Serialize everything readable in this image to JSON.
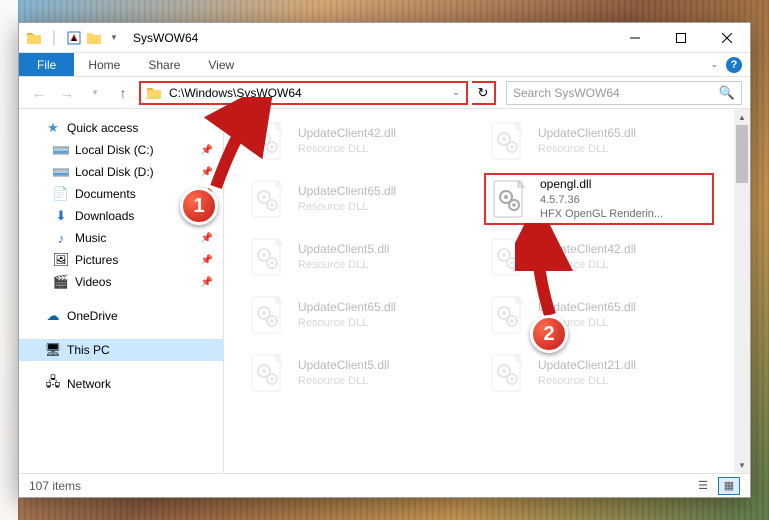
{
  "title": "SysWOW64",
  "ribbon": {
    "file": "File",
    "home": "Home",
    "share": "Share",
    "view": "View"
  },
  "address": {
    "path": "C:\\Windows\\SysWOW64"
  },
  "search": {
    "placeholder": "Search SysWOW64"
  },
  "nav": {
    "quick": "Quick access",
    "cdrive": "Local Disk (C:)",
    "ddrive": "Local Disk (D:)",
    "docs": "Documents",
    "downloads": "Downloads",
    "music": "Music",
    "pics": "Pictures",
    "videos": "Videos",
    "onedrive": "OneDrive",
    "thispc": "This PC",
    "network": "Network"
  },
  "files": [
    {
      "name": "UpdateClient42.dll",
      "sub1": "Resource DLL",
      "sub2": ""
    },
    {
      "name": "UpdateClient65.dll",
      "sub1": "Resource DLL",
      "sub2": ""
    },
    {
      "name": "UpdateClient65.dll",
      "sub1": "Resource DLL",
      "sub2": ""
    },
    {
      "name": "opengl.dll",
      "sub1": "4.5.7.36",
      "sub2": "HFX OpenGL Renderin..."
    },
    {
      "name": "UpdateClient5.dll",
      "sub1": "Resource DLL",
      "sub2": ""
    },
    {
      "name": "UpdateClient42.dll",
      "sub1": "Resource DLL",
      "sub2": ""
    },
    {
      "name": "UpdateClient65.dll",
      "sub1": "Resource DLL",
      "sub2": ""
    },
    {
      "name": "UpdateClient65.dll",
      "sub1": "Resource DLL",
      "sub2": ""
    },
    {
      "name": "UpdateClient5.dll",
      "sub1": "Resource DLL",
      "sub2": ""
    },
    {
      "name": "UpdateClient21.dll",
      "sub1": "Resource DLL",
      "sub2": ""
    }
  ],
  "callouts": {
    "c1": "1",
    "c2": "2"
  },
  "status": {
    "count": "107 items"
  }
}
